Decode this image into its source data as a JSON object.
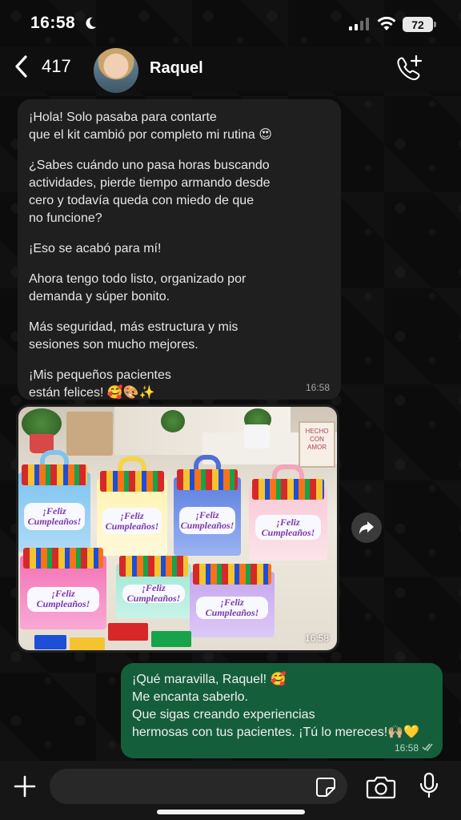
{
  "status_bar": {
    "time": "16:58",
    "battery": "72"
  },
  "header": {
    "back_count": "417",
    "contact_name": "Raquel"
  },
  "messages": {
    "incoming_text": {
      "paragraphs": [
        "¡Hola! Solo pasaba para contarte\nque el kit cambió por completo mi rutina 😍",
        "¿Sabes cuándo uno pasa horas buscando\nactividades, pierde tiempo armando desde\ncero y todavía queda con miedo de que\nno funcione?",
        "¡Eso se acabó para mí!",
        "Ahora tengo todo listo, organizado por\ndemanda y súper bonito.",
        "Más seguridad, más estructura y mis\nsesiones son mucho mejores.",
        "¡Mis pequeños pacientes\nestán felices! 🥰🎨✨"
      ],
      "time": "16:58"
    },
    "incoming_image": {
      "time": "16:58",
      "box_label": "¡Feliz Cumpleaños!",
      "sign_text": "HECHO CON AMOR"
    },
    "outgoing_text": {
      "lines": [
        "¡Qué maravilla, Raquel! 🥰",
        "Me encanta saberlo.",
        "Que sigas creando experiencias",
        "hermosas con tus pacientes. ¡Tú lo mereces!🙌🏼💛"
      ],
      "time": "16:58"
    }
  },
  "composer": {
    "placeholder": ""
  },
  "icons": {
    "moon": "moon-icon",
    "signal": "signal-icon",
    "wifi": "wifi-icon",
    "back": "chevron-left-icon",
    "call_add": "phone-plus-icon",
    "forward": "forward-icon",
    "add": "plus-icon",
    "sticker": "sticker-icon",
    "camera": "camera-icon",
    "mic": "microphone-icon"
  },
  "colors": {
    "incoming_bubble": "#1f1f1f",
    "outgoing_bubble": "#155e3b",
    "background": "#0b0b0b"
  }
}
